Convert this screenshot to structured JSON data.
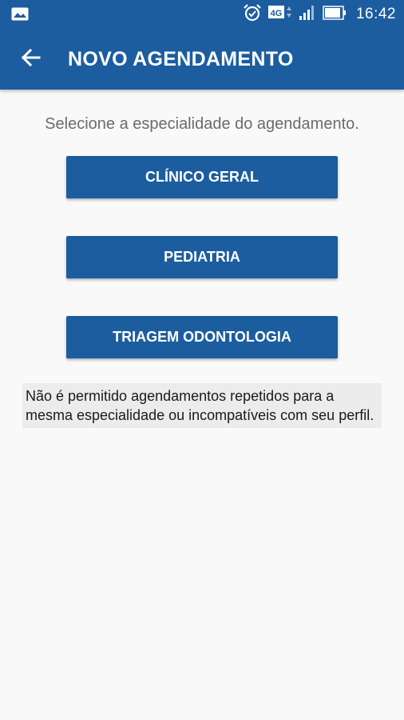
{
  "status_bar": {
    "icons": [
      "gallery-icon",
      "alarm-icon",
      "network-4g-icon",
      "signal-icon",
      "battery-icon"
    ],
    "network_type": "4G",
    "time": "16:42"
  },
  "app_bar": {
    "back_icon": "arrow-left-icon",
    "title": "NOVO AGENDAMENTO"
  },
  "content": {
    "subtitle": "Selecione a especialidade do agendamento.",
    "specialties": [
      {
        "label": "CLÍNICO GERAL"
      },
      {
        "label": "PEDIATRIA"
      },
      {
        "label": "TRIAGEM ODONTOLOGIA"
      }
    ],
    "notice": "Não é permitido agendamentos repetidos para a mesma especialidade ou incompatíveis com seu perfil."
  },
  "colors": {
    "primary": "#1c5da0",
    "background": "#f9f9f9",
    "notice_background": "#ececec"
  }
}
